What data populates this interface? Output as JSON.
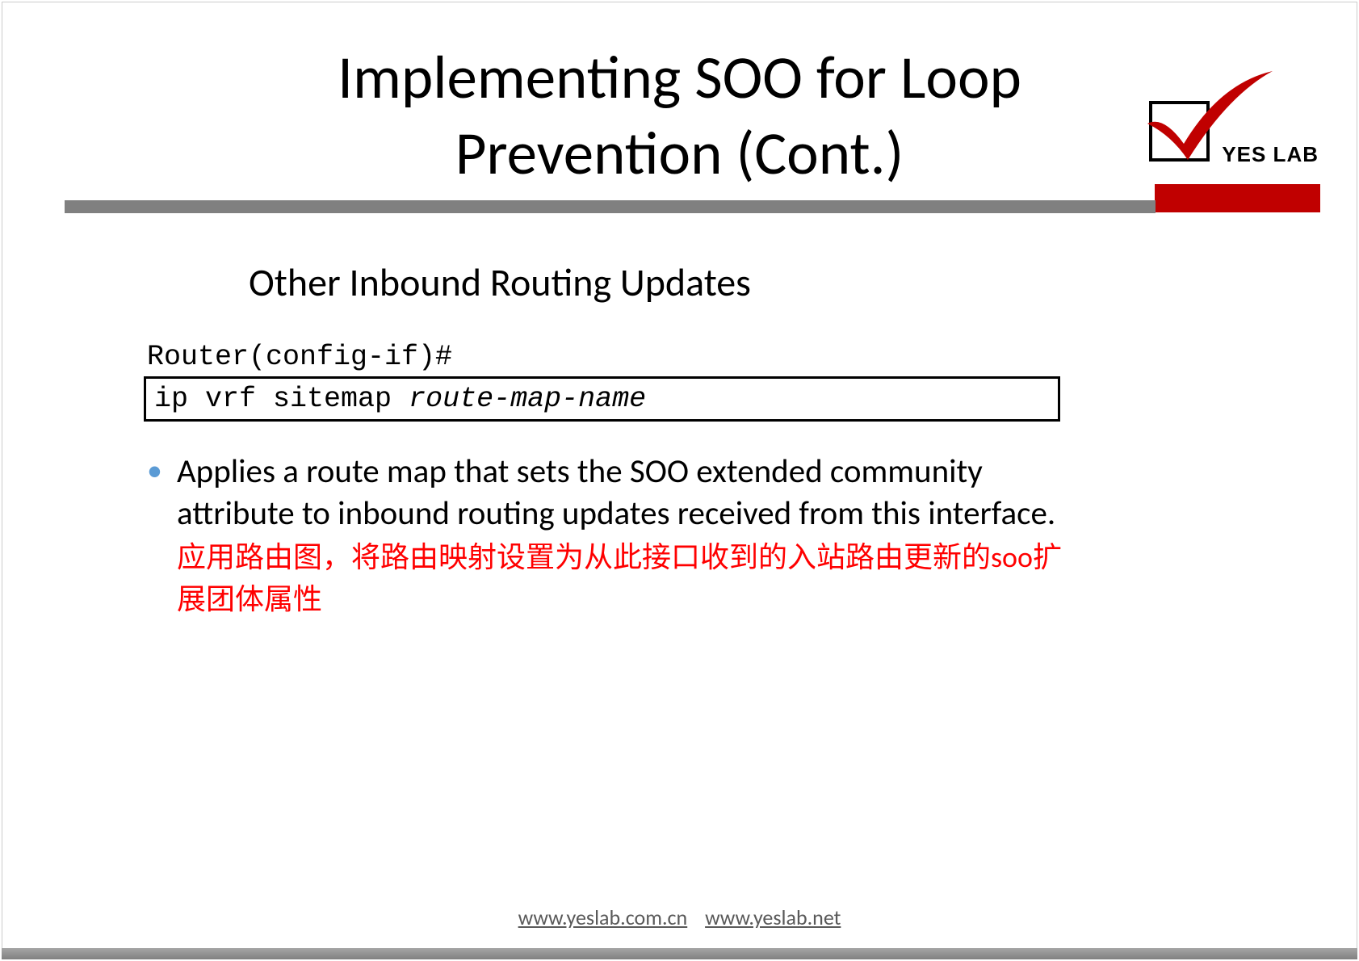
{
  "title": "Implementing SOO for Loop Prevention (Cont.)",
  "logo": {
    "text": "YES LAB"
  },
  "subtitle": "Other Inbound Routing Updates",
  "prompt": "Router(config-if)#",
  "command": {
    "fixed": "ip vrf sitemap ",
    "italic": "route-map-name"
  },
  "bullet": {
    "english": "Applies a route map that sets the SOO extended community attribute to inbound routing updates received from this interface.",
    "chinese": "应用路由图，将路由映射设置为从此接口收到的入站路由更新的soo扩展团体属性"
  },
  "footer": {
    "link1": "www.yeslab.com.cn",
    "link2": "www.yeslab.net"
  }
}
